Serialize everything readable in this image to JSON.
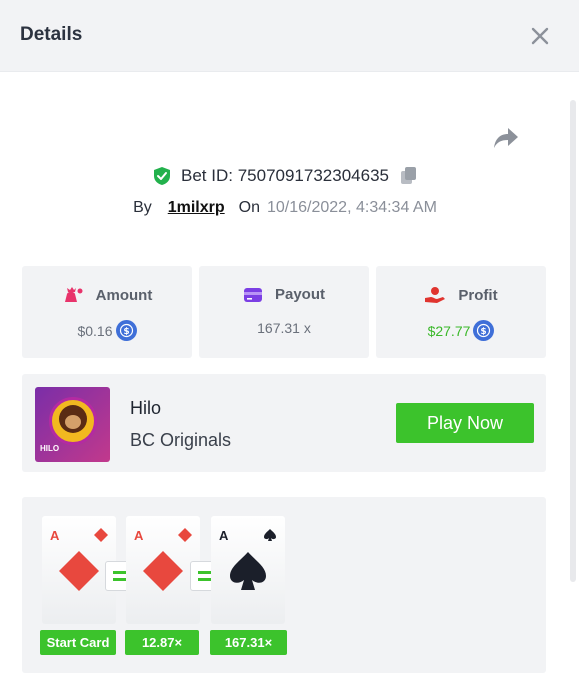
{
  "header": {
    "title": "Details"
  },
  "bet": {
    "id_label": "Bet ID: 7507091732304635",
    "by_label": "By",
    "user": "1milxrp",
    "on_label": "On",
    "date": "10/16/2022, 4:34:34 AM"
  },
  "stats": {
    "amount": {
      "label": "Amount",
      "value": "$0.16"
    },
    "payout": {
      "label": "Payout",
      "value": "167.31 x"
    },
    "profit": {
      "label": "Profit",
      "value": "$27.77"
    }
  },
  "game": {
    "name": "Hilo",
    "provider": "BC Originals",
    "thumb_tag": "HILO",
    "play_label": "Play Now"
  },
  "cards": [
    {
      "rank": "A",
      "suit": "diamonds",
      "tag": "Start Card"
    },
    {
      "rank": "A",
      "suit": "diamonds",
      "tag": "12.87×"
    },
    {
      "rank": "A",
      "suit": "spades",
      "tag": "167.31×"
    }
  ],
  "colors": {
    "accent_green": "#3cc32c",
    "profit_green": "#3bb82a",
    "diamond_red": "#e8483e",
    "coin_blue": "#3f6fd8"
  },
  "icons": {
    "close": "close-icon",
    "share": "share-icon",
    "verified": "shield-check-icon",
    "copy": "copy-icon",
    "amount": "money-bag-icon",
    "payout": "card-icon",
    "profit": "hand-coin-icon",
    "coin": "coin-icon"
  }
}
